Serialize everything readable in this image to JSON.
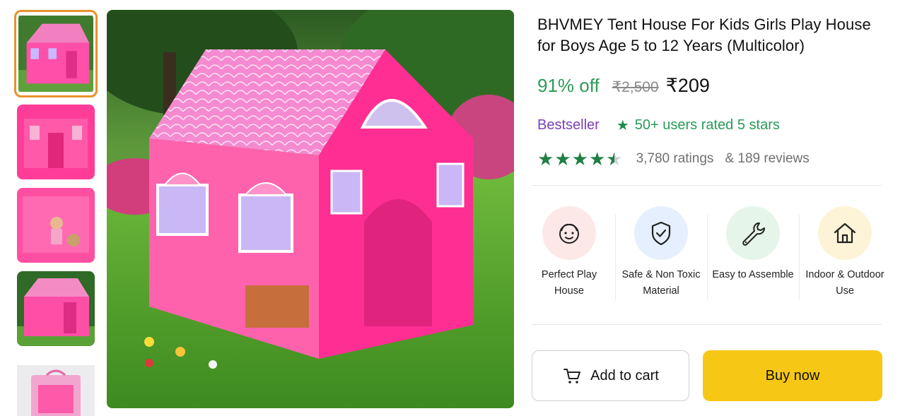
{
  "product": {
    "title": "BHVMEY Tent House For Kids Girls Play House for Boys Age 5 to 12 Years (Multicolor)"
  },
  "pricing": {
    "discount": "91% off",
    "mrp": "₹2,500",
    "price": "₹209"
  },
  "badges": {
    "bestseller": "Bestseller",
    "rated": "50+ users rated 5 stars"
  },
  "rating": {
    "value": 4.5,
    "ratings_text": "3,780 ratings",
    "reviews_text": "& 189 reviews"
  },
  "features": [
    {
      "label": "Perfect Play House",
      "icon": "smiley-face-icon",
      "bg": "#fde8e8"
    },
    {
      "label": "Safe & Non Toxic Material",
      "icon": "shield-check-icon",
      "bg": "#e6effd"
    },
    {
      "label": "Easy to Assemble",
      "icon": "wrench-icon",
      "bg": "#e6f5e9"
    },
    {
      "label": "Indoor & Outdoor Use",
      "icon": "home-icon",
      "bg": "#fdf3d6"
    }
  ],
  "actions": {
    "add_to_cart": "Add to cart",
    "buy_now": "Buy now"
  },
  "colors": {
    "discount_green": "#2e9a57",
    "bestseller_purple": "#7a3fb6",
    "star_green": "#1f7f45",
    "buy_yellow": "#f6c715",
    "thumb_selected": "#e8912d"
  }
}
